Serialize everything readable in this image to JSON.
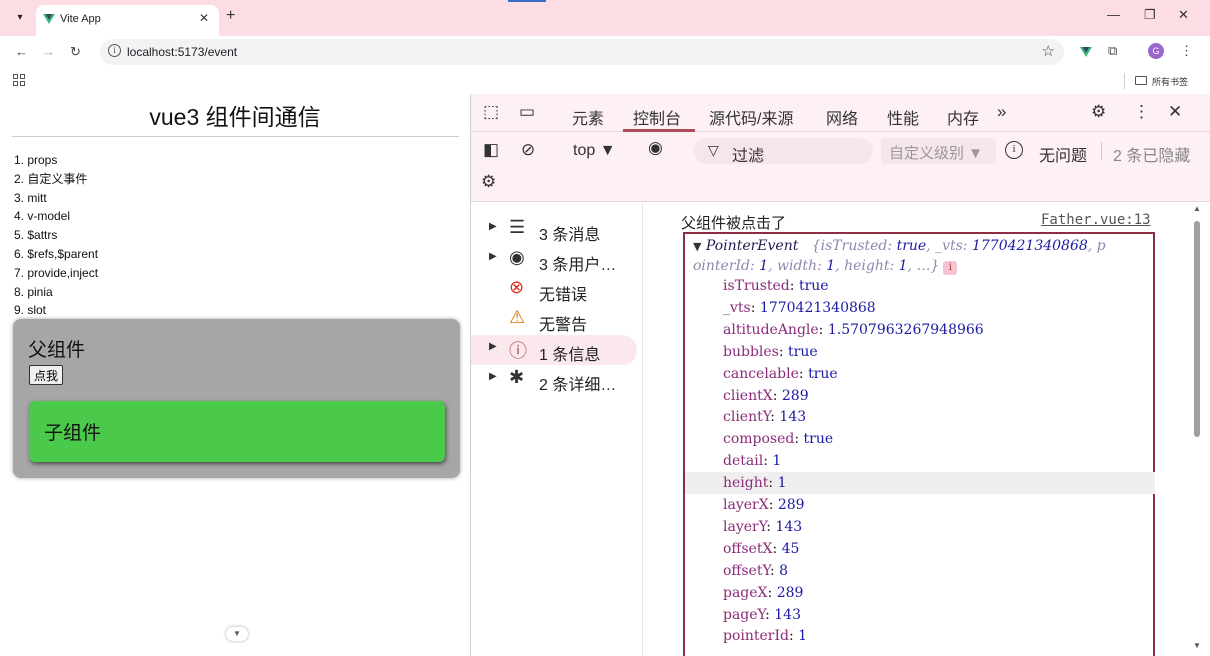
{
  "browser": {
    "tab_title": "Vite App",
    "url": "localhost:5173/event",
    "bookmarks_folder": "所有书签",
    "profile_initial": "G"
  },
  "page": {
    "title": "vue3 组件间通信",
    "menu": [
      "1. props",
      "2. 自定义事件",
      "3. mitt",
      "4. v-model",
      "5. $attrs",
      "6. $refs,$parent",
      "7. provide,inject",
      "8. pinia",
      "9. slot"
    ],
    "father_title": "父组件",
    "father_button": "点我",
    "child_title": "子组件"
  },
  "devtools": {
    "tabs": [
      "元素",
      "控制台",
      "源代码/来源",
      "网络",
      "性能",
      "内存"
    ],
    "active_tab": "控制台",
    "context": "top ▼",
    "filter_placeholder": "过滤",
    "levels": "自定义级别 ▼",
    "issues": "无问题",
    "hidden": "2 条已隐藏",
    "sidebar": [
      {
        "arrow": "▶",
        "icon": "☰",
        "label": "3 条消息",
        "name": "messages"
      },
      {
        "arrow": "▶",
        "icon": "◉",
        "label": "3 条用户…",
        "name": "user-messages"
      },
      {
        "arrow": "",
        "icon": "⊗",
        "label": "无错误",
        "name": "errors"
      },
      {
        "arrow": "",
        "icon": "⚠",
        "label": "无警告",
        "name": "warnings"
      },
      {
        "arrow": "▶",
        "icon": "ⓘ",
        "label": "1 条信息",
        "name": "info"
      },
      {
        "arrow": "▶",
        "icon": "✱",
        "label": "2 条详细…",
        "name": "verbose"
      }
    ],
    "console": {
      "log_text": "父组件被点击了",
      "log_source": "Father.vue:13",
      "object_head": {
        "type": "PointerEvent",
        "summary_1": "{isTrusted: ",
        "summary_1_val": "true",
        "summary_2": ", _vts: ",
        "summary_2_val": "1770421340868",
        "summary_3": ", p",
        "summary_4": "ointerId: ",
        "summary_4_val": "1",
        "summary_5": ", width: ",
        "summary_5_val": "1",
        "summary_6": ", height: ",
        "summary_6_val": "1",
        "summary_7": ",  …}"
      },
      "properties": [
        {
          "key": "isTrusted",
          "value": "true"
        },
        {
          "key": "_vts",
          "value": "1770421340868"
        },
        {
          "key": "altitudeAngle",
          "value": "1.5707963267948966"
        },
        {
          "key": "bubbles",
          "value": "true"
        },
        {
          "key": "cancelable",
          "value": "true"
        },
        {
          "key": "clientX",
          "value": "289"
        },
        {
          "key": "clientY",
          "value": "143"
        },
        {
          "key": "composed",
          "value": "true"
        },
        {
          "key": "detail",
          "value": "1"
        },
        {
          "key": "height",
          "value": "1"
        },
        {
          "key": "layerX",
          "value": "289"
        },
        {
          "key": "layerY",
          "value": "143"
        },
        {
          "key": "offsetX",
          "value": "45"
        },
        {
          "key": "offsetY",
          "value": "8"
        },
        {
          "key": "pageX",
          "value": "289"
        },
        {
          "key": "pageY",
          "value": "143"
        },
        {
          "key": "pointerId",
          "value": "1"
        }
      ],
      "highlighted_property": "height"
    }
  },
  "colors": {
    "chrome_tab_strip": "#fcdde3",
    "devtools_bg": "#fdf1f3",
    "child_green": "#4ac94b",
    "father_gray": "#a6a6a6",
    "object_border": "#8b2e44"
  }
}
